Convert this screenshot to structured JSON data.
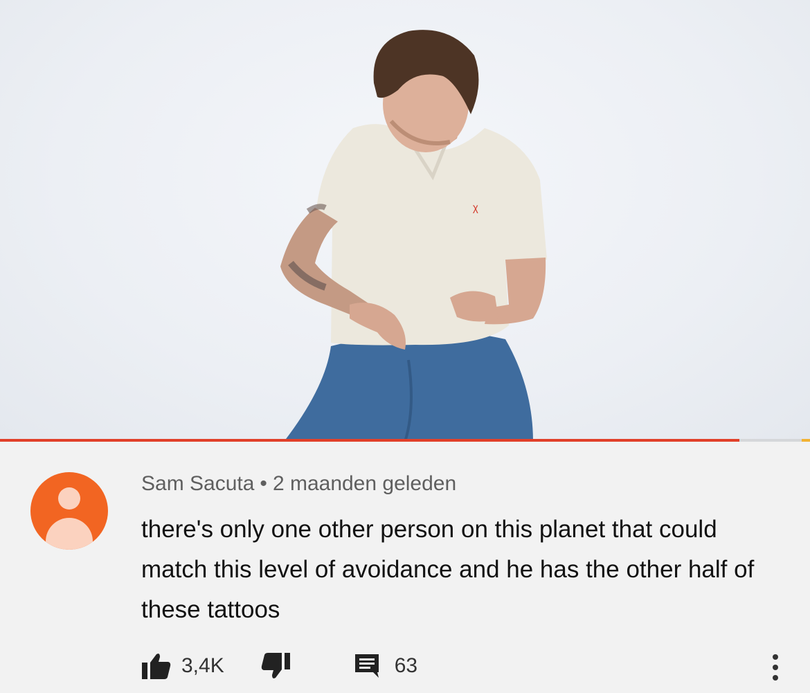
{
  "video": {
    "progress_fraction": 0.913,
    "colors": {
      "played": "#e1402a",
      "buffer_tip": "#f2b233"
    }
  },
  "comment": {
    "author": "Sam Sacuta",
    "separator": "•",
    "time": "2 maanden geleden",
    "text": "there's only one other person on this planet that could match this level of avoidance and he has the other half of these tattoos",
    "likes": "3,4K",
    "replies": "63",
    "avatar_color": "#f26522",
    "icons": {
      "like": "thumbs-up-icon",
      "dislike": "thumbs-down-icon",
      "reply": "comment-icon",
      "more": "more-vertical-icon"
    }
  }
}
